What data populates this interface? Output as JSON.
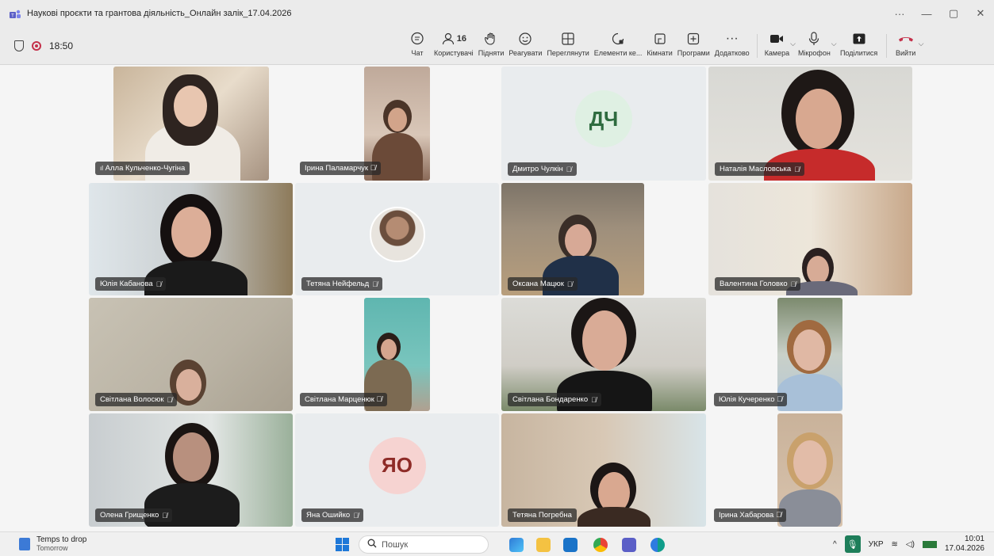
{
  "window": {
    "title": "Наукові проєкти та грантова діяльність_Онлайн залік_17.04.2026",
    "controls": [
      "···",
      "—",
      "▢",
      "✕"
    ]
  },
  "meeting": {
    "timer": "18:50",
    "participant_count": "16"
  },
  "toolbar": {
    "chat": "Чат",
    "people": "Користувачі",
    "raise": "Підняти",
    "react": "Реагувати",
    "view": "Переглянути",
    "elements": "Елементи ке...",
    "rooms": "Кімнати",
    "apps": "Програми",
    "more": "Додатково",
    "camera": "Камера",
    "mic": "Мікрофон",
    "share": "Поділитися",
    "leave": "Вийти",
    "more_dots": "···"
  },
  "participants": [
    {
      "name": "Алла Кульченко-Чугіна",
      "type": "video",
      "speaking": true
    },
    {
      "name": "Ірина Паламарчук",
      "type": "video",
      "muted": true
    },
    {
      "name": "Дмитро Чулкін",
      "type": "initials",
      "initials": "ДЧ",
      "color": "#dff0e3",
      "text_color": "#2e6b3f",
      "muted": true
    },
    {
      "name": "Наталія Масловська",
      "type": "video",
      "muted": true
    },
    {
      "name": "Юлія Кабанова",
      "type": "video",
      "muted": true
    },
    {
      "name": "Тетяна Нейфельд",
      "type": "photo",
      "muted": true
    },
    {
      "name": "Оксана Мацюк",
      "type": "video",
      "muted": true
    },
    {
      "name": "Валентина Головко",
      "type": "video",
      "muted": true
    },
    {
      "name": "Світлана Волосюк",
      "type": "video",
      "muted": true
    },
    {
      "name": "Світлана Марценюк",
      "type": "video",
      "muted": true
    },
    {
      "name": "Світлана Бондаренко",
      "type": "video",
      "muted": true
    },
    {
      "name": "Юлія Кучеренко",
      "type": "video",
      "muted": true
    },
    {
      "name": "Олена Грищенко",
      "type": "video",
      "muted": true
    },
    {
      "name": "Яна Ошийко",
      "type": "initials",
      "initials": "ЯО",
      "color": "#f6d3d1",
      "text_color": "#8e2b27",
      "muted": true
    },
    {
      "name": "Тетяна Погребна",
      "type": "video",
      "muted": false
    },
    {
      "name": "Ірина Хабарова",
      "type": "video",
      "muted": true
    }
  ],
  "taskbar": {
    "weather_title": "Temps to drop",
    "weather_sub": "Tomorrow",
    "search_placeholder": "Пошук",
    "language": "УКР",
    "time": "10:01",
    "date": "17.04.2026"
  },
  "colors": {
    "record": "#c4314b",
    "leave": "#c4314b",
    "label_bg": "#282828"
  }
}
